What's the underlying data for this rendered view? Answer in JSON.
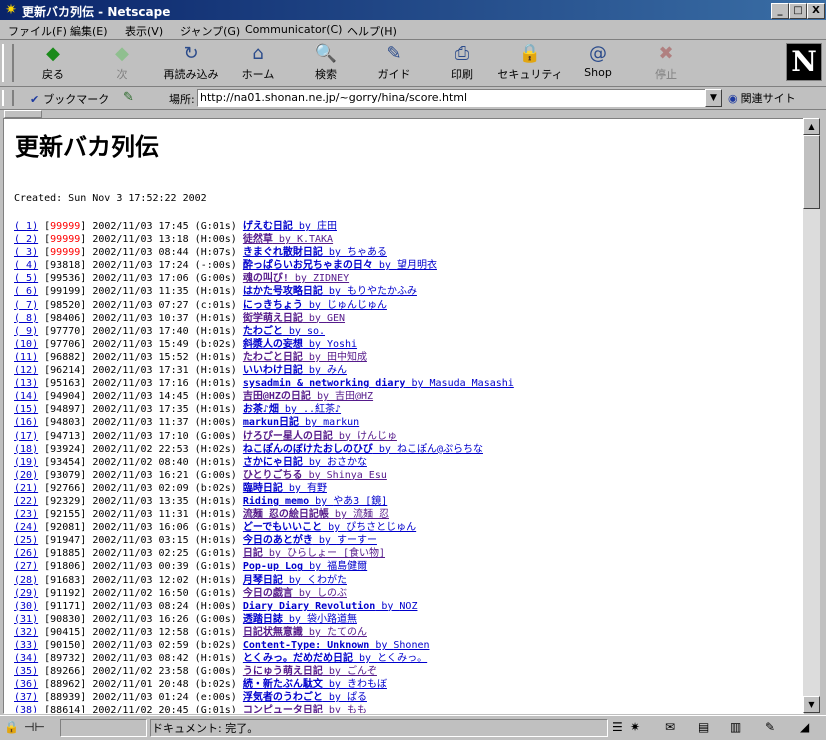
{
  "window": {
    "title": "更新バカ列伝 - Netscape",
    "min": "_",
    "max": "□",
    "close": "X"
  },
  "menu": [
    "ファイル(F)",
    "編集(E)",
    "表示(V)",
    "ジャンプ(G)",
    "Communicator(C)",
    "ヘルプ(H)"
  ],
  "toolbar": [
    {
      "label": "戻る",
      "icon": "◆"
    },
    {
      "label": "次",
      "icon": "◆"
    },
    {
      "label": "再読み込み",
      "icon": "↻"
    },
    {
      "label": "ホーム",
      "icon": "⌂"
    },
    {
      "label": "検索",
      "icon": "🔍"
    },
    {
      "label": "ガイド",
      "icon": "✎"
    },
    {
      "label": "印刷",
      "icon": "⎙"
    },
    {
      "label": "セキュリティ",
      "icon": "🔒"
    },
    {
      "label": "Shop",
      "icon": "@"
    },
    {
      "label": "停止",
      "icon": "✖"
    }
  ],
  "logo": "N",
  "location": {
    "bookmark_label": "ブックマーク",
    "label": "場所:",
    "url": "http://na01.shonan.ne.jp/~gorry/hina/score.html",
    "related": "関連サイト"
  },
  "page": {
    "title": "更新バカ列伝",
    "created": "Created: Sun Nov 3 17:52:22 2002"
  },
  "rows": [
    {
      "n": "1",
      "score": "99999",
      "red": true,
      "date": "2002/11/03 17:45",
      "g": "(G:01s)",
      "title": "げえむ日記",
      "by": "庄田"
    },
    {
      "n": "2",
      "score": "99999",
      "red": true,
      "date": "2002/11/03 13:18",
      "g": "(H:00s)",
      "title": "徒然草",
      "by": "K.TAKA"
    },
    {
      "n": "3",
      "score": "99999",
      "red": true,
      "date": "2002/11/03 08:44",
      "g": "(H:07s)",
      "title": "きまぐれ散財日記",
      "by": "ちゃある"
    },
    {
      "n": "4",
      "score": "93818",
      "red": false,
      "date": "2002/11/03 17:24",
      "g": "(-:00s)",
      "title": "酔っぱらいお兄ちゃまの日々",
      "by": "望月明衣"
    },
    {
      "n": "5",
      "score": "99536",
      "red": false,
      "date": "2002/11/03 17:06",
      "g": "(G:00s)",
      "title": "魂の叫び!",
      "by": "ZIDNEY"
    },
    {
      "n": "6",
      "score": "99199",
      "red": false,
      "date": "2002/11/03 11:35",
      "g": "(H:01s)",
      "title": "はかた号攻略日記",
      "by": "もりやたかふみ"
    },
    {
      "n": "7",
      "score": "98520",
      "red": false,
      "date": "2002/11/03 07:27",
      "g": "(c:01s)",
      "title": "にっきちょう",
      "by": "じゅんじゅん"
    },
    {
      "n": "8",
      "score": "98406",
      "red": false,
      "date": "2002/11/03 10:37",
      "g": "(H:01s)",
      "title": "衒学萌え日記",
      "by": "GEN"
    },
    {
      "n": "9",
      "score": "97770",
      "red": false,
      "date": "2002/11/03 17:40",
      "g": "(H:01s)",
      "title": "たわごと",
      "by": "so."
    },
    {
      "n": "10",
      "score": "97706",
      "red": false,
      "date": "2002/11/03 15:49",
      "g": "(b:02s)",
      "title": "斜漿人の妄想",
      "by": "Yoshi"
    },
    {
      "n": "11",
      "score": "96882",
      "red": false,
      "date": "2002/11/03 15:52",
      "g": "(H:01s)",
      "title": "たわごと日記",
      "by": "田中知成"
    },
    {
      "n": "12",
      "score": "96214",
      "red": false,
      "date": "2002/11/03 17:31",
      "g": "(H:01s)",
      "title": "いいわけ日記",
      "by": "みん"
    },
    {
      "n": "13",
      "score": "95163",
      "red": false,
      "date": "2002/11/03 17:16",
      "g": "(H:01s)",
      "title": "sysadmin & networking diary",
      "by": "Masuda Masashi"
    },
    {
      "n": "14",
      "score": "94904",
      "red": false,
      "date": "2002/11/03 14:45",
      "g": "(H:00s)",
      "title": "吉田@HZの日記",
      "by": "吉田@HZ"
    },
    {
      "n": "15",
      "score": "94897",
      "red": false,
      "date": "2002/11/03 17:35",
      "g": "(H:01s)",
      "title": "お茶♪畑",
      "by": "..紅茶♪"
    },
    {
      "n": "16",
      "score": "94803",
      "red": false,
      "date": "2002/11/03 11:37",
      "g": "(H:00s)",
      "title": "markun日記",
      "by": "markun"
    },
    {
      "n": "17",
      "score": "94713",
      "red": false,
      "date": "2002/11/03 17:10",
      "g": "(G:00s)",
      "title": "けろぴー星人の日記",
      "by": "けんじゅ"
    },
    {
      "n": "18",
      "score": "93924",
      "red": false,
      "date": "2002/11/02 22:53",
      "g": "(H:02s)",
      "title": "ねこぽんのぼけたおしのひび",
      "by": "ねこぽん@ぷらちな"
    },
    {
      "n": "19",
      "score": "93454",
      "red": false,
      "date": "2002/11/02 08:40",
      "g": "(H:01s)",
      "title": "さかにゃ日記",
      "by": "おさかな"
    },
    {
      "n": "20",
      "score": "93079",
      "red": false,
      "date": "2002/11/03 16:21",
      "g": "(G:00s)",
      "title": "ひとりごちる",
      "by": "Shinya Esu"
    },
    {
      "n": "21",
      "score": "92766",
      "red": false,
      "date": "2002/11/03 02:09",
      "g": "(b:02s)",
      "title": "臨時日記",
      "by": "有野"
    },
    {
      "n": "22",
      "score": "92329",
      "red": false,
      "date": "2002/11/03 13:35",
      "g": "(H:01s)",
      "title": "Riding memo",
      "by": "やあ3 [鏡]"
    },
    {
      "n": "23",
      "score": "92155",
      "red": false,
      "date": "2002/11/03 11:31",
      "g": "(H:01s)",
      "title": "流麺 忍の絵日記帳",
      "by": "流麺 忍"
    },
    {
      "n": "24",
      "score": "92081",
      "red": false,
      "date": "2002/11/03 16:06",
      "g": "(G:01s)",
      "title": "どーでもいいこと",
      "by": "ぴちさとじゅん"
    },
    {
      "n": "25",
      "score": "91947",
      "red": false,
      "date": "2002/11/03 03:15",
      "g": "(H:01s)",
      "title": "今日のあとがき",
      "by": "すーすー"
    },
    {
      "n": "26",
      "score": "91885",
      "red": false,
      "date": "2002/11/03 02:25",
      "g": "(G:01s)",
      "title": "日記",
      "by": "ひらしょー [食い物]"
    },
    {
      "n": "27",
      "score": "91806",
      "red": false,
      "date": "2002/11/03 00:39",
      "g": "(G:01s)",
      "title": "Pop-up Log",
      "by": "福島健爾"
    },
    {
      "n": "28",
      "score": "91683",
      "red": false,
      "date": "2002/11/03 12:02",
      "g": "(H:01s)",
      "title": "月琴日記",
      "by": "くわがた"
    },
    {
      "n": "29",
      "score": "91192",
      "red": false,
      "date": "2002/11/02 16:50",
      "g": "(G:01s)",
      "title": "今日の戯言",
      "by": "しのぶ"
    },
    {
      "n": "30",
      "score": "91171",
      "red": false,
      "date": "2002/11/03 08:24",
      "g": "(H:00s)",
      "title": "Diary Diary Revolution",
      "by": "NOZ"
    },
    {
      "n": "31",
      "score": "90830",
      "red": false,
      "date": "2002/11/03 16:26",
      "g": "(G:00s)",
      "title": "透踏日誌",
      "by": "袋小路道無"
    },
    {
      "n": "32",
      "score": "90415",
      "red": false,
      "date": "2002/11/03 12:58",
      "g": "(G:01s)",
      "title": "日記状無意識",
      "by": "たてのん"
    },
    {
      "n": "33",
      "score": "90150",
      "red": false,
      "date": "2002/11/03 02:59",
      "g": "(b:02s)",
      "title": "Content-Type: Unknown",
      "by": "Shonen"
    },
    {
      "n": "34",
      "score": "89732",
      "red": false,
      "date": "2002/11/03 08:42",
      "g": "(H:01s)",
      "title": "とくみっ。だめだめ日記",
      "by": "とくみっ。"
    },
    {
      "n": "35",
      "score": "89266",
      "red": false,
      "date": "2002/11/02 23:58",
      "g": "(G:00s)",
      "title": "うにゅう萌え日記",
      "by": "ごんぞ"
    },
    {
      "n": "36",
      "score": "88962",
      "red": false,
      "date": "2002/11/01 20:48",
      "g": "(b:02s)",
      "title": "続・新たぶん駄文",
      "by": "きわもぼ"
    },
    {
      "n": "37",
      "score": "88939",
      "red": false,
      "date": "2002/11/03 01:24",
      "g": "(e:00s)",
      "title": "浮気者のうわごと",
      "by": "ぱる"
    },
    {
      "n": "38",
      "score": "88614",
      "red": false,
      "date": "2002/11/02 20:45",
      "g": "(G:01s)",
      "title": "コンピュータ日記",
      "by": "もも"
    }
  ],
  "status": {
    "text": "ドキュメント: 完了。"
  }
}
